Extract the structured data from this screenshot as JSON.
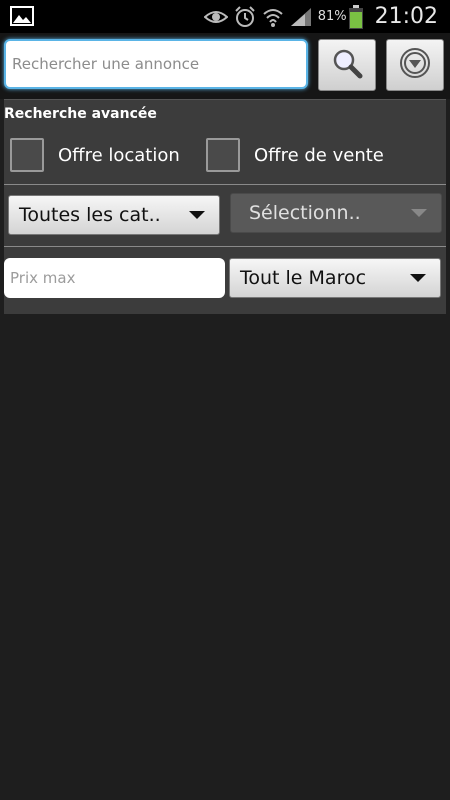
{
  "status_bar": {
    "left_icon": "gallery-icon",
    "icons": [
      "eye-icon",
      "alarm-icon",
      "wifi-icon",
      "signal-icon"
    ],
    "battery_percent": "81%",
    "time": "21:02"
  },
  "search": {
    "placeholder": "Rechercher une annonce",
    "search_button_icon": "magnifier-icon",
    "filter_button_icon": "dropdown-circle-icon"
  },
  "advanced": {
    "title": "Recherche avancée",
    "checkbox_rent_label": "Offre location",
    "checkbox_sale_label": "Offre de vente",
    "category_selected": "Toutes les cat..",
    "subcategory_selected": "Sélectionn..",
    "price_placeholder": "Prix max",
    "region_selected": "Tout le Maroc"
  },
  "colors": {
    "accent": "#5ab4e6",
    "battery": "#7ac143",
    "background": "#1e1e1e",
    "panel": "#3c3c3c"
  }
}
